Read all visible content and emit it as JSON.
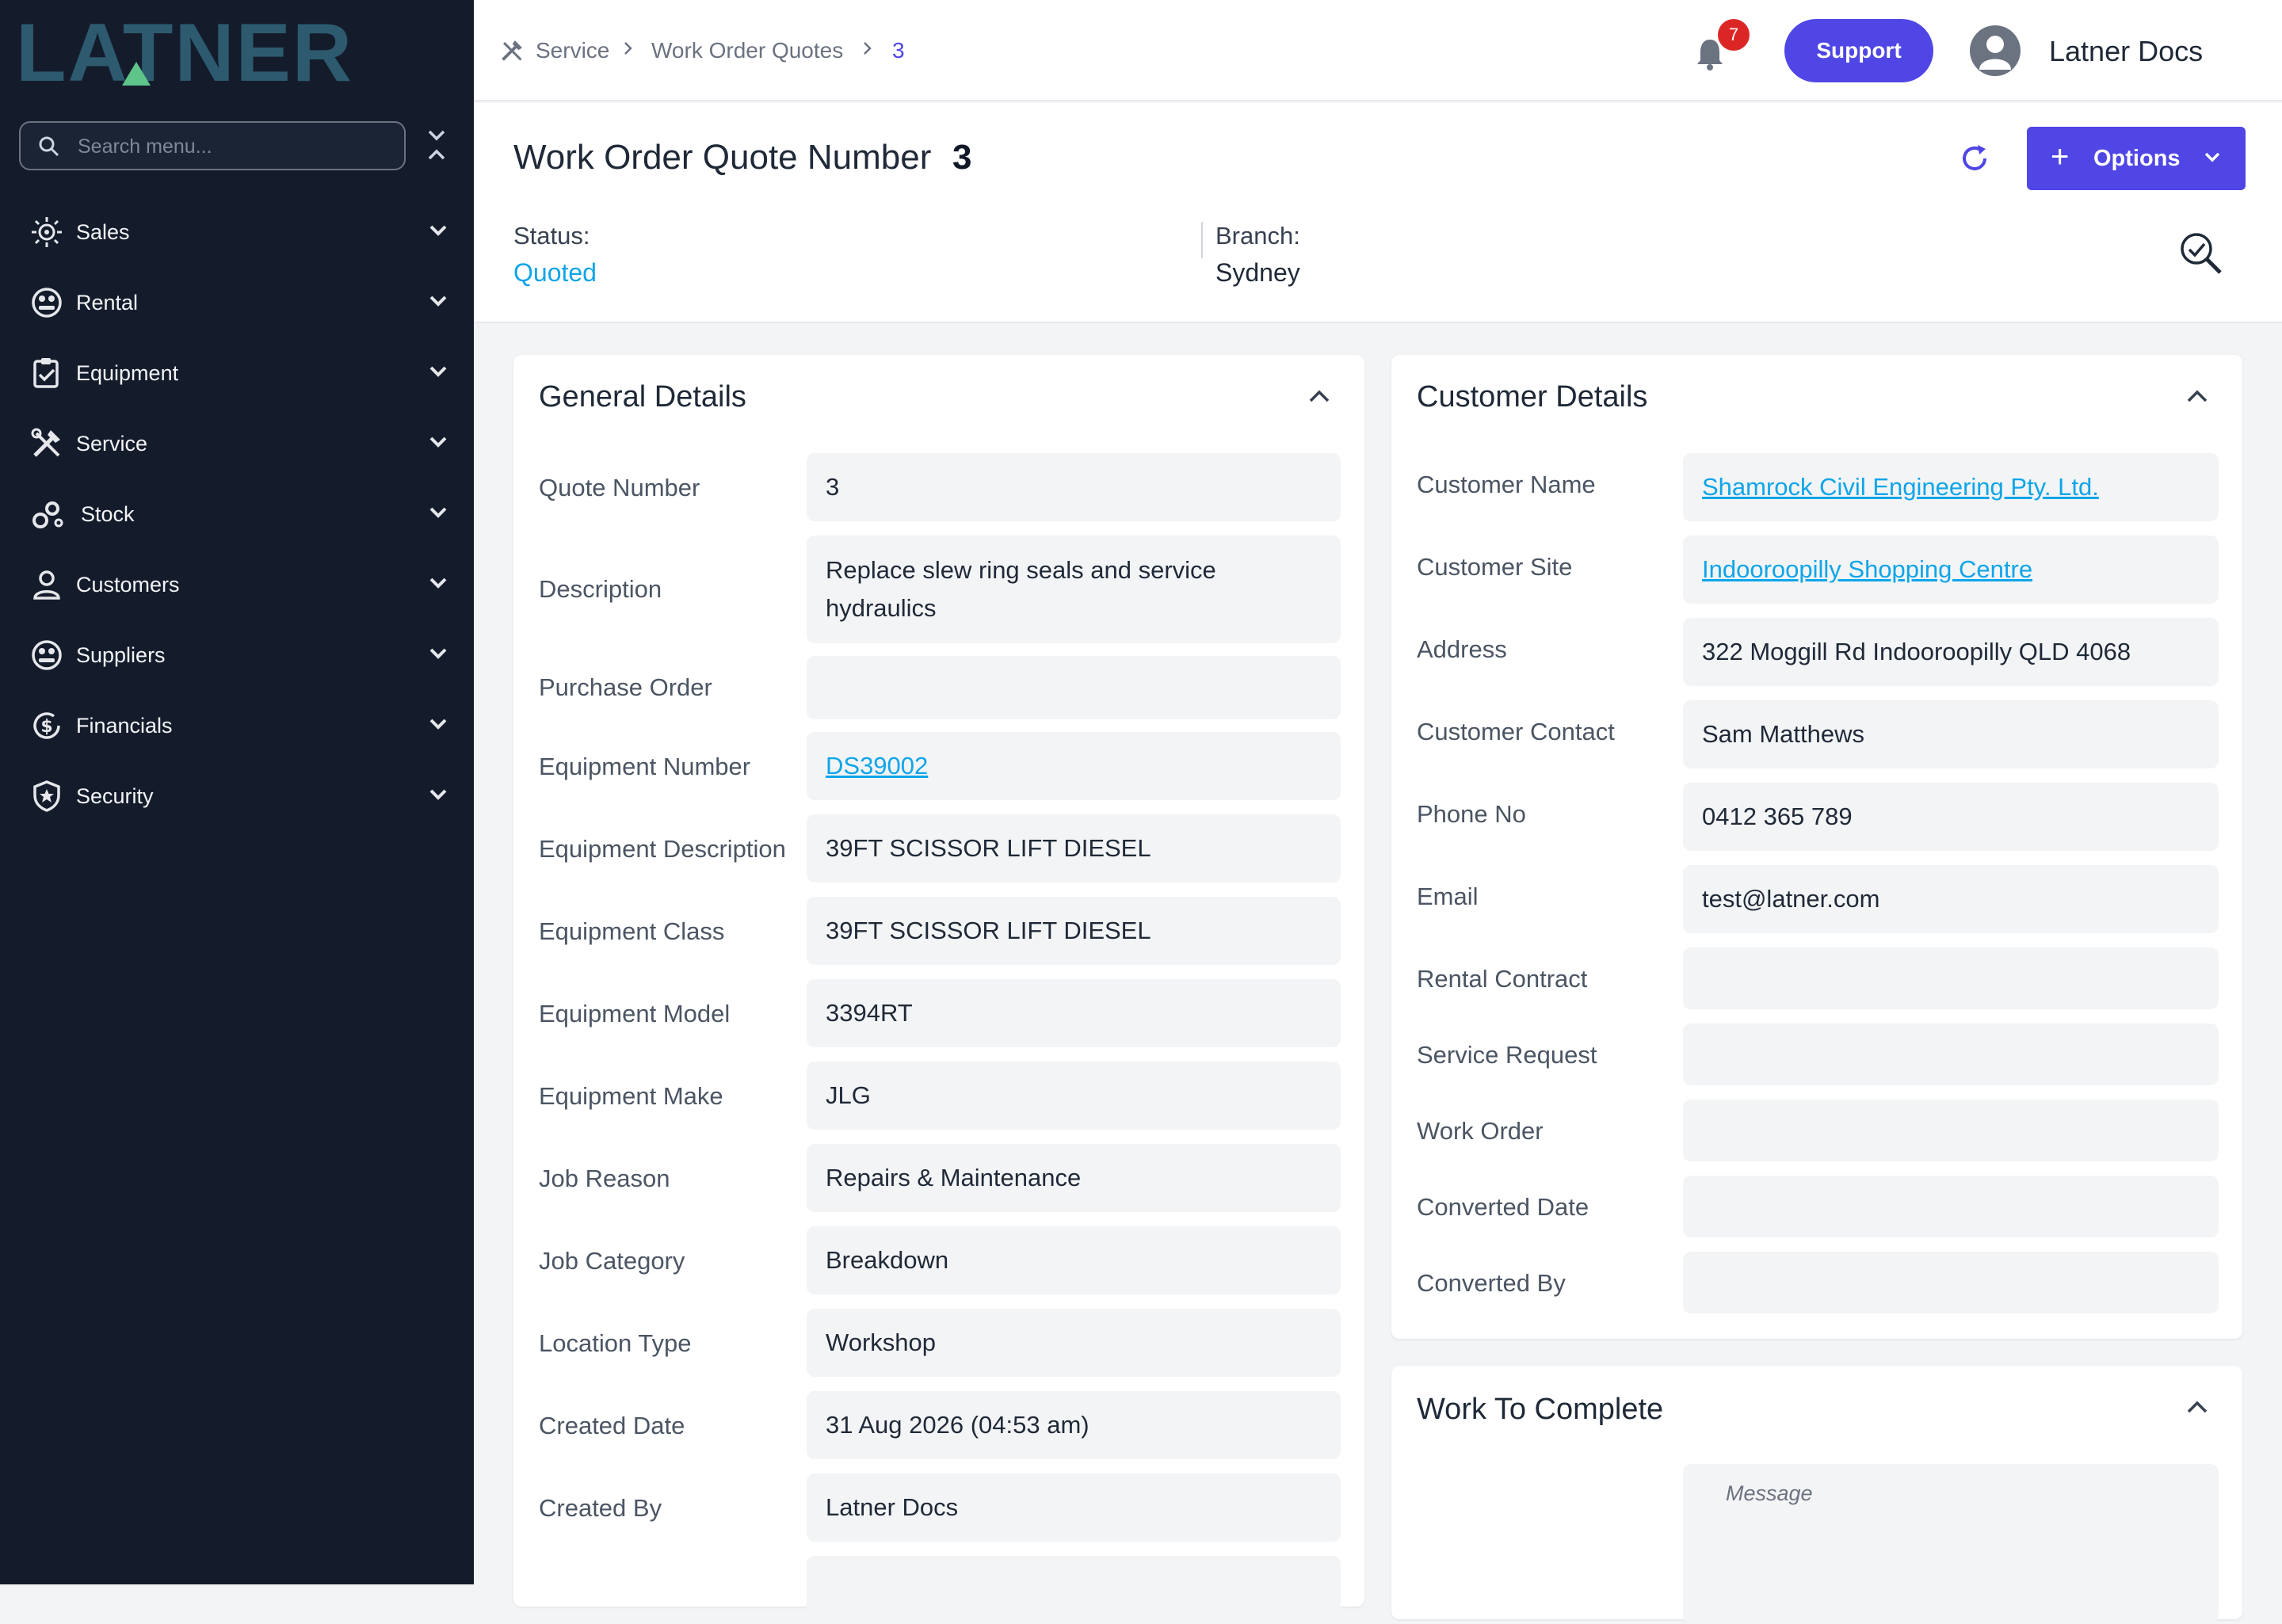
{
  "app": {
    "logo_text": "LATNER",
    "brand_color": "#4f46e5",
    "logo_color": "#2d5a6e",
    "logo_accent": "#5ec48a"
  },
  "sidebar": {
    "search_placeholder": "Search menu...",
    "items": [
      {
        "label": "Sales",
        "icon": "sales-icon"
      },
      {
        "label": "Rental",
        "icon": "rental-icon"
      },
      {
        "label": "Equipment",
        "icon": "clipboard-icon"
      },
      {
        "label": "Service",
        "icon": "tools-icon"
      },
      {
        "label": "Stock",
        "icon": "gears-icon"
      },
      {
        "label": "Customers",
        "icon": "person-icon"
      },
      {
        "label": "Suppliers",
        "icon": "supplier-icon"
      },
      {
        "label": "Financials",
        "icon": "dollar-icon"
      },
      {
        "label": "Security",
        "icon": "shield-icon"
      }
    ]
  },
  "topbar": {
    "breadcrumb": [
      "Service",
      "Work Order Quotes",
      "3"
    ],
    "notification_count": "7",
    "support_label": "Support",
    "user_name": "Latner Docs"
  },
  "header": {
    "title": "Work Order Quote Number",
    "number": "3",
    "options_label": "Options",
    "status_label": "Status:",
    "status_value": "Quoted",
    "branch_label": "Branch:",
    "branch_value": "Sydney"
  },
  "general": {
    "title": "General Details",
    "rows": [
      {
        "label": "Quote Number",
        "value": "3"
      },
      {
        "label": "Description",
        "value": "Replace slew ring seals and service hydraulics"
      },
      {
        "label": "Purchase Order",
        "value": ""
      },
      {
        "label": "Equipment Number",
        "value": "DS39002",
        "link": true
      },
      {
        "label": "Equipment Description",
        "value": "39FT SCISSOR LIFT DIESEL"
      },
      {
        "label": "Equipment Class",
        "value": "39FT SCISSOR LIFT DIESEL"
      },
      {
        "label": "Equipment Model",
        "value": "3394RT"
      },
      {
        "label": "Equipment Make",
        "value": "JLG"
      },
      {
        "label": "Job Reason",
        "value": "Repairs & Maintenance"
      },
      {
        "label": "Job Category",
        "value": "Breakdown"
      },
      {
        "label": "Location Type",
        "value": "Workshop"
      },
      {
        "label": "Created Date",
        "value": "31 Aug 2026 (04:53 am)"
      },
      {
        "label": "Created By",
        "value": "Latner Docs"
      }
    ]
  },
  "customer": {
    "title": "Customer Details",
    "rows": [
      {
        "label": "Customer Name",
        "value": "Shamrock Civil Engineering Pty. Ltd.",
        "link": true
      },
      {
        "label": "Customer Site",
        "value": "Indooroopilly Shopping Centre",
        "link": true
      },
      {
        "label": "Address",
        "value": "322 Moggill Rd Indooroopilly QLD 4068"
      },
      {
        "label": "Customer Contact",
        "value": "Sam Matthews"
      },
      {
        "label": "Phone No",
        "value": "0412 365 789"
      },
      {
        "label": "Email",
        "value": "test@latner.com"
      },
      {
        "label": "Rental Contract",
        "value": ""
      },
      {
        "label": "Service Request",
        "value": ""
      },
      {
        "label": "Work Order",
        "value": ""
      },
      {
        "label": "Converted Date",
        "value": ""
      },
      {
        "label": "Converted By",
        "value": ""
      }
    ]
  },
  "work": {
    "title": "Work To Complete",
    "message_placeholder": "Message"
  }
}
